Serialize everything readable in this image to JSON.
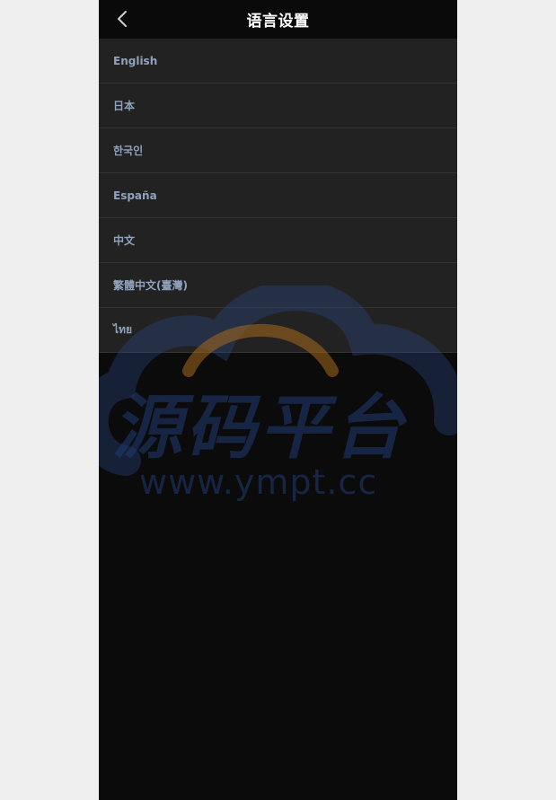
{
  "header": {
    "title": "语言设置",
    "back_icon": "chevron-left-icon"
  },
  "languages": [
    {
      "label": "English"
    },
    {
      "label": "日本"
    },
    {
      "label": "한국인"
    },
    {
      "label": "España"
    },
    {
      "label": "中文"
    },
    {
      "label": "繁體中文(臺灣)"
    },
    {
      "label": "ไทย"
    }
  ],
  "watermark": {
    "title": "源码平台",
    "url": "www.ympt.cc"
  },
  "colors": {
    "page_bg": "#efefef",
    "app_bg": "#0b0b0b",
    "list_item_bg": "#222222",
    "label_color": "#8fa3bd",
    "title_color": "#ffffff"
  }
}
